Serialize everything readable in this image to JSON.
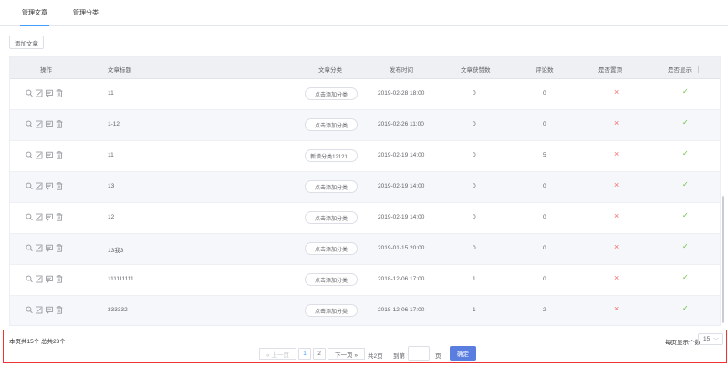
{
  "tabs": [
    {
      "label": "管理文章",
      "active": true
    },
    {
      "label": "管理分类",
      "active": false
    }
  ],
  "toolbar": {
    "add_label": "添加文章"
  },
  "table": {
    "columns": [
      "操作",
      "文章标题",
      "文章分类",
      "发布时间",
      "文章获赞数",
      "评论数",
      "是否置顶",
      "是否显示"
    ],
    "rows": [
      {
        "title": "11",
        "category": "点击添加分类",
        "published": "2019-02-28 18:00",
        "likes": "0",
        "comments": "0",
        "pinned": "×",
        "shown": "✓"
      },
      {
        "title": "1-12",
        "category": "点击添加分类",
        "published": "2019-02-26 11:00",
        "likes": "0",
        "comments": "0",
        "pinned": "×",
        "shown": "✓"
      },
      {
        "title": "11",
        "category": "新增分类12121...",
        "published": "2019-02-19 14:00",
        "likes": "0",
        "comments": "5",
        "pinned": "×",
        "shown": "✓"
      },
      {
        "title": "13",
        "category": "点击添加分类",
        "published": "2019-02-19 14:00",
        "likes": "0",
        "comments": "0",
        "pinned": "×",
        "shown": "✓"
      },
      {
        "title": "12",
        "category": "点击添加分类",
        "published": "2019-02-19 14:00",
        "likes": "0",
        "comments": "0",
        "pinned": "×",
        "shown": "✓"
      },
      {
        "title": "13我3",
        "category": "点击添加分类",
        "published": "2019-01-15 20:00",
        "likes": "0",
        "comments": "0",
        "pinned": "×",
        "shown": "✓"
      },
      {
        "title": "111111111",
        "category": "点击添加分类",
        "published": "2018-12-06 17:00",
        "likes": "1",
        "comments": "0",
        "pinned": "×",
        "shown": "✓"
      },
      {
        "title": "333332",
        "category": "点击添加分类",
        "published": "2018-12-06 17:00",
        "likes": "1",
        "comments": "2",
        "pinned": "×",
        "shown": "✓"
      }
    ],
    "row_actions": [
      "search-icon",
      "edit-icon",
      "comment-icon",
      "delete-icon"
    ]
  },
  "footer": {
    "summary": "本页共15个  总共23个",
    "page_size_label": "每页显示个数",
    "page_size_value": "15",
    "pagination": {
      "prev": "« 上一页",
      "pages": [
        "1",
        "2"
      ],
      "current": "1",
      "next": "下一页 »",
      "total": "共2页",
      "goto": "到第",
      "unit": "页",
      "confirm": "确定"
    }
  },
  "colors": {
    "accent": "#409eff",
    "confirm": "#5a7ee0",
    "cross": "#f56c6c",
    "check": "#67c23a",
    "highlight_border": "#e33333"
  }
}
